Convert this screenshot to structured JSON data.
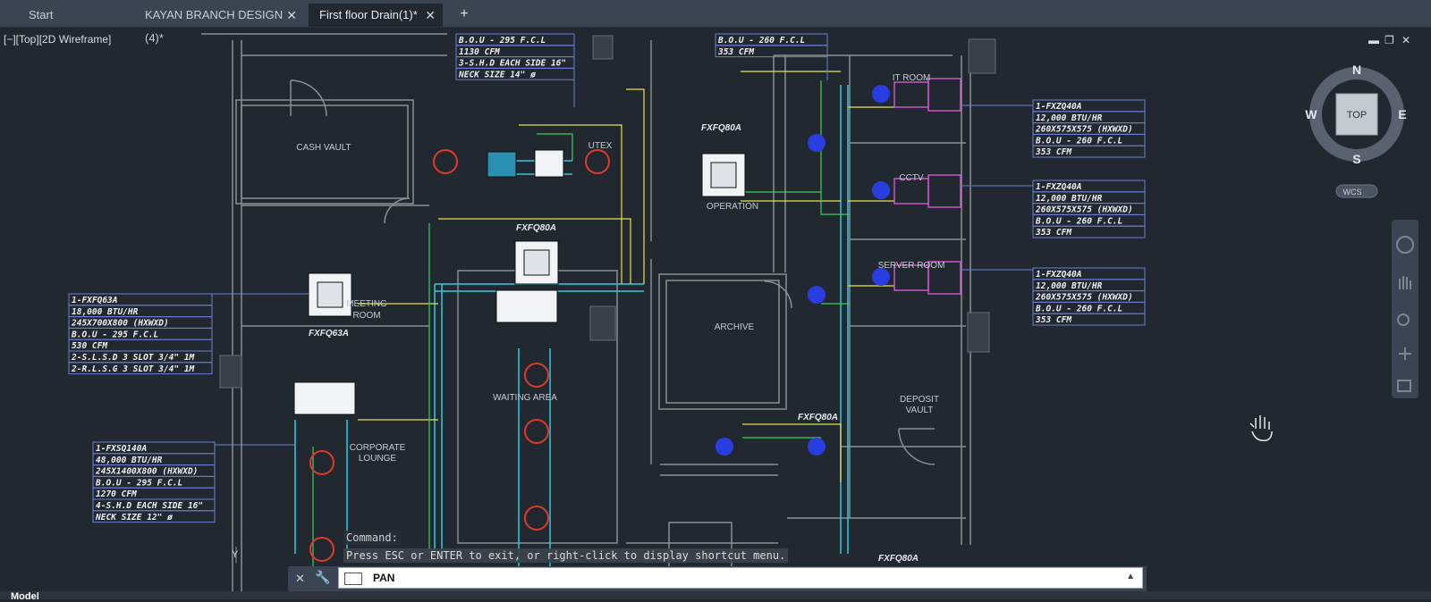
{
  "tabs": [
    {
      "label": "Start",
      "close": ""
    },
    {
      "label": "KAYAN BRANCH DESIGN (4)*",
      "close": "✕"
    },
    {
      "label": "First floor Drain(1)*",
      "close": "✕"
    }
  ],
  "new_tab": "+",
  "viewport_label": "[−][Top][2D Wireframe]",
  "window_controls": {
    "minimize": "▬",
    "restore": "❐",
    "close": "✕"
  },
  "viewcube": {
    "n": "N",
    "s": "S",
    "e": "E",
    "w": "W",
    "top": "TOP",
    "wcs": "WCS"
  },
  "rooms": {
    "cash_vault": "CASH VAULT",
    "utex": "UTEX",
    "operation": "OPERATION",
    "it_room": "IT ROOM",
    "cctv": "CCTV",
    "server_room": "SERVER ROOM",
    "meeting": "MEETING",
    "room": "ROOM",
    "archive": "ARCHIVE",
    "waiting": "WAITING AREA",
    "corporate": "CORPORATE",
    "lounge": "LOUNGE",
    "deposit": "DEPOSIT",
    "vault": "VAULT"
  },
  "unit_labels": {
    "fxfq80a_1": "FXFQ80A",
    "fxfq80a_2": "FXFQ80A",
    "fxfq63a": "FXFQ63A",
    "fxfq80a_3": "FXFQ80A",
    "fxfq80a_4": "FXFQ80A"
  },
  "notes": {
    "top_left": [
      "B.O.U  -  295 F.C.L",
      "1130 CFM",
      "3-S.H.D EACH SIDE 16\"",
      "NECK SIZE 14\" ø"
    ],
    "top_mid": [
      "B.O.U  -  260 F.C.L",
      "353 CFM"
    ],
    "fxfq63a": [
      "1-FXFQ63A",
      "18,000 BTU/HR",
      "245X700X800 (HXWXD)",
      "B.O.U  -  295 F.C.L",
      "530 CFM",
      "2-S.L.S.D 3 SLOT 3/4\" 1M",
      "2-R.L.S.G 3 SLOT 3/4\" 1M"
    ],
    "fxsq140a": [
      "1-FXSQ140A",
      "48,000 BTU/HR",
      "245X1400X800 (HXWXD)",
      "B.O.U  -  295 F.C.L",
      "1270 CFM",
      "4-S.H.D EACH SIDE 16\"",
      "NECK SIZE 12\" ø"
    ],
    "fxzq_1": [
      "1-FXZQ40A",
      "12,000 BTU/HR",
      "260X575X575 (HXWXD)",
      "B.O.U  -  260 F.C.L",
      "353 CFM"
    ],
    "fxzq_2": [
      "1-FXZQ40A",
      "12,000 BTU/HR",
      "260X575X575 (HXWXD)",
      "B.O.U  -  260 F.C.L",
      "353 CFM"
    ],
    "fxzq_3": [
      "1-FXZQ40A",
      "12,000 BTU/HR",
      "260X575X575 (HXWXD)",
      "B.O.U  -  260 F.C.L",
      "353 CFM"
    ]
  },
  "command": {
    "history": "Command:",
    "message": "Press ESC or ENTER to exit, or right-click to display shortcut menu.",
    "input": "PAN"
  },
  "model_tab": "Model",
  "colors": {
    "wall": "#8a8f96",
    "cyan": "#36c8e0",
    "yellow": "#e6e34a",
    "green": "#3bd15a",
    "red": "#e03a2a",
    "magenta": "#e05ce0",
    "blue": "#2a3de0",
    "note": "#6d7ed6"
  }
}
